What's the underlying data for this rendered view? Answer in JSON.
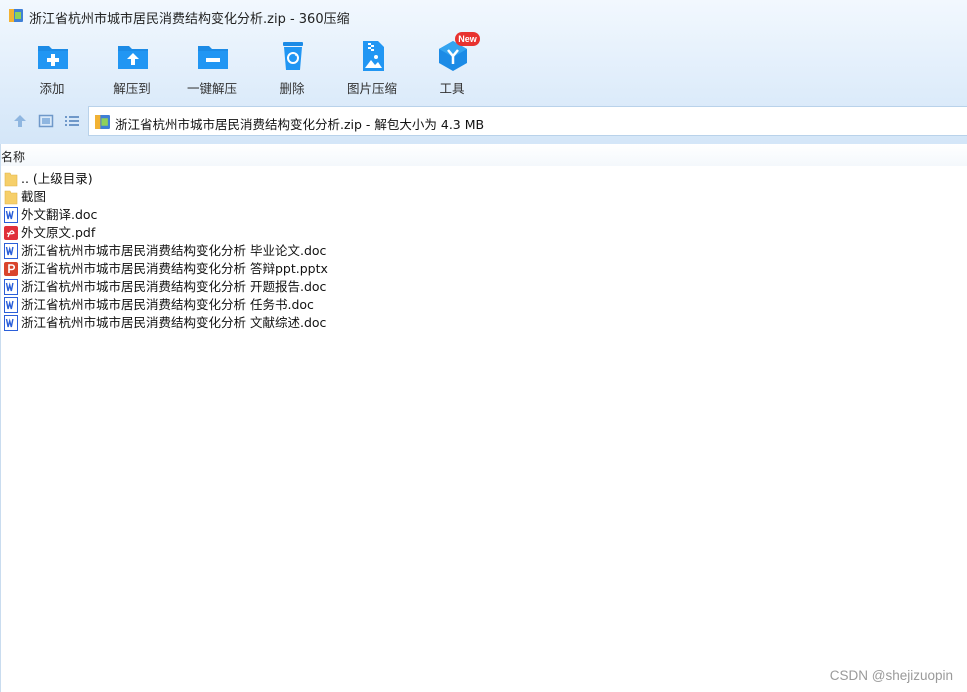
{
  "window": {
    "title": "浙江省杭州市城市居民消费结构变化分析.zip - 360压缩"
  },
  "toolbar": {
    "buttons": [
      {
        "label": "添加",
        "icon": "add-folder-icon"
      },
      {
        "label": "解压到",
        "icon": "extract-to-folder-icon"
      },
      {
        "label": "一键解压",
        "icon": "one-click-extract-icon"
      },
      {
        "label": "删除",
        "icon": "recycle-delete-icon"
      },
      {
        "label": "图片压缩",
        "icon": "image-compress-icon"
      },
      {
        "label": "工具",
        "icon": "tools-icon",
        "badge": "New"
      }
    ]
  },
  "address": {
    "path": "浙江省杭州市城市居民消费结构变化分析.zip - 解包大小为 4.3 MB"
  },
  "list": {
    "column_name": "名称",
    "files": [
      {
        "name": ".. (上级目录)",
        "type": "folder"
      },
      {
        "name": "截图",
        "type": "folder"
      },
      {
        "name": "外文翻译.doc",
        "type": "word"
      },
      {
        "name": "外文原文.pdf",
        "type": "pdf"
      },
      {
        "name": "浙江省杭州市城市居民消费结构变化分析 毕业论文.doc",
        "type": "word"
      },
      {
        "name": "浙江省杭州市城市居民消费结构变化分析 答辩ppt.pptx",
        "type": "ppt"
      },
      {
        "name": "浙江省杭州市城市居民消费结构变化分析 开题报告.doc",
        "type": "word"
      },
      {
        "name": "浙江省杭州市城市居民消费结构变化分析 任务书.doc",
        "type": "word"
      },
      {
        "name": "浙江省杭州市城市居民消费结构变化分析 文献综述.doc",
        "type": "word"
      }
    ]
  },
  "watermark": "CSDN @shejizuopin",
  "colors": {
    "accent": "#1c8be6",
    "word": "#2b5fd9",
    "pdf": "#e0303a",
    "ppt": "#d9442b",
    "folder": "#f6cf6a"
  }
}
